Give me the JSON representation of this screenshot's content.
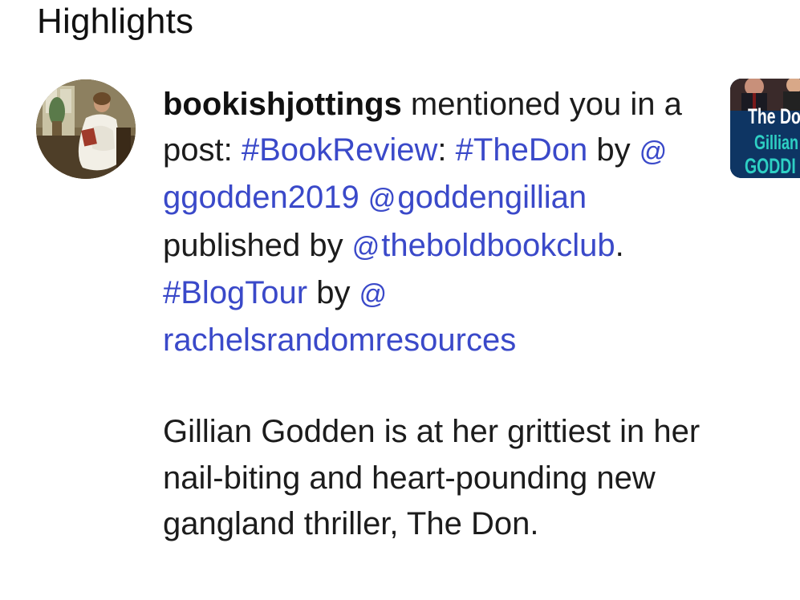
{
  "section": {
    "title": "Highlights"
  },
  "notification": {
    "username": "bookishjottings",
    "action_text": " mentioned you in a post: ",
    "tag_bookreview": "#BookReview",
    "colon": ":",
    "tag_thedon": "#TheDon",
    "by1": " by ",
    "mention_ggodden": "ggodden2019",
    "mention_goddengillian": "goddengillian",
    "published_by": " published by ",
    "mention_boldbookclub": "theboldbookclub",
    "period": ". ",
    "tag_blogtour": "#BlogTour",
    "by2": " by ",
    "mention_rachels": "rachelsrandomresources",
    "description": "Gillian Godden is at her grittiest in her nail-biting and heart-pounding new gangland thriller, The Don.",
    "mention_icon": "threads-at-icon"
  },
  "thumbnail": {
    "line1": "The Do",
    "line2": "Gillian",
    "line3": "GODDI"
  },
  "colors": {
    "link": "#3a49c9",
    "text": "#1c1c1c",
    "thumb_bg": "#0c2f55",
    "thumb_accent": "#2ed0c4"
  }
}
